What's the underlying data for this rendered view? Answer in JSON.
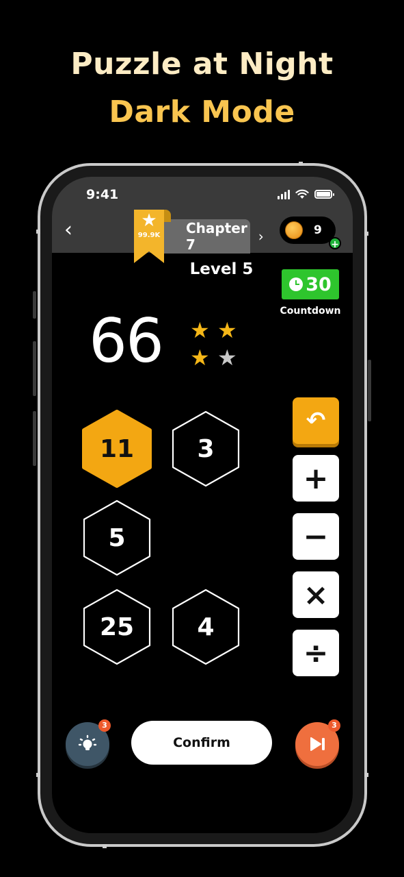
{
  "headline": {
    "line1": "Puzzle at Night",
    "line2": "Dark Mode"
  },
  "status_bar": {
    "time": "9:41"
  },
  "header": {
    "back_icon": "‹",
    "ribbon_star": "★",
    "stars_total": "99.9K",
    "chapter_label": "Chapter 7",
    "chapter_chevron": "›",
    "coins": "9",
    "coin_add": "+"
  },
  "level": {
    "title": "Level 5"
  },
  "timer": {
    "value": "30",
    "label": "Countdown"
  },
  "target": {
    "value": "66"
  },
  "rating": {
    "earned": 3,
    "total": 4,
    "star_glyph": "★"
  },
  "tiles": [
    {
      "value": "11",
      "selected": true
    },
    {
      "value": "3",
      "selected": false
    },
    {
      "value": "5",
      "selected": false
    },
    {
      "value": "25",
      "selected": false
    },
    {
      "value": "4",
      "selected": false
    }
  ],
  "operators": {
    "undo": "↶",
    "add": "+",
    "subtract": "−",
    "multiply": "×",
    "divide": "÷"
  },
  "bottom": {
    "hint_icon": "💡",
    "hint_count": "3",
    "confirm_label": "Confirm",
    "skip_icon": "▶|",
    "skip_count": "3"
  },
  "colors": {
    "accent": "#f3a712",
    "timer_green": "#2ec52d",
    "hint_blue": "#3f5667",
    "skip_orange": "#ef6f3e"
  }
}
